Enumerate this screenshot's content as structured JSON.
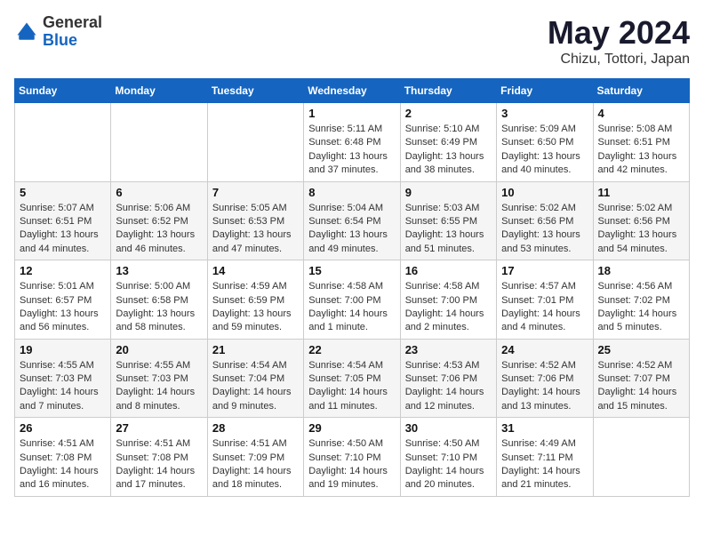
{
  "header": {
    "logo_general": "General",
    "logo_blue": "Blue",
    "month_title": "May 2024",
    "location": "Chizu, Tottori, Japan"
  },
  "weekdays": [
    "Sunday",
    "Monday",
    "Tuesday",
    "Wednesday",
    "Thursday",
    "Friday",
    "Saturday"
  ],
  "weeks": [
    [
      {
        "day": "",
        "info": ""
      },
      {
        "day": "",
        "info": ""
      },
      {
        "day": "",
        "info": ""
      },
      {
        "day": "1",
        "info": "Sunrise: 5:11 AM\nSunset: 6:48 PM\nDaylight: 13 hours and 37 minutes."
      },
      {
        "day": "2",
        "info": "Sunrise: 5:10 AM\nSunset: 6:49 PM\nDaylight: 13 hours and 38 minutes."
      },
      {
        "day": "3",
        "info": "Sunrise: 5:09 AM\nSunset: 6:50 PM\nDaylight: 13 hours and 40 minutes."
      },
      {
        "day": "4",
        "info": "Sunrise: 5:08 AM\nSunset: 6:51 PM\nDaylight: 13 hours and 42 minutes."
      }
    ],
    [
      {
        "day": "5",
        "info": "Sunrise: 5:07 AM\nSunset: 6:51 PM\nDaylight: 13 hours and 44 minutes."
      },
      {
        "day": "6",
        "info": "Sunrise: 5:06 AM\nSunset: 6:52 PM\nDaylight: 13 hours and 46 minutes."
      },
      {
        "day": "7",
        "info": "Sunrise: 5:05 AM\nSunset: 6:53 PM\nDaylight: 13 hours and 47 minutes."
      },
      {
        "day": "8",
        "info": "Sunrise: 5:04 AM\nSunset: 6:54 PM\nDaylight: 13 hours and 49 minutes."
      },
      {
        "day": "9",
        "info": "Sunrise: 5:03 AM\nSunset: 6:55 PM\nDaylight: 13 hours and 51 minutes."
      },
      {
        "day": "10",
        "info": "Sunrise: 5:02 AM\nSunset: 6:56 PM\nDaylight: 13 hours and 53 minutes."
      },
      {
        "day": "11",
        "info": "Sunrise: 5:02 AM\nSunset: 6:56 PM\nDaylight: 13 hours and 54 minutes."
      }
    ],
    [
      {
        "day": "12",
        "info": "Sunrise: 5:01 AM\nSunset: 6:57 PM\nDaylight: 13 hours and 56 minutes."
      },
      {
        "day": "13",
        "info": "Sunrise: 5:00 AM\nSunset: 6:58 PM\nDaylight: 13 hours and 58 minutes."
      },
      {
        "day": "14",
        "info": "Sunrise: 4:59 AM\nSunset: 6:59 PM\nDaylight: 13 hours and 59 minutes."
      },
      {
        "day": "15",
        "info": "Sunrise: 4:58 AM\nSunset: 7:00 PM\nDaylight: 14 hours and 1 minute."
      },
      {
        "day": "16",
        "info": "Sunrise: 4:58 AM\nSunset: 7:00 PM\nDaylight: 14 hours and 2 minutes."
      },
      {
        "day": "17",
        "info": "Sunrise: 4:57 AM\nSunset: 7:01 PM\nDaylight: 14 hours and 4 minutes."
      },
      {
        "day": "18",
        "info": "Sunrise: 4:56 AM\nSunset: 7:02 PM\nDaylight: 14 hours and 5 minutes."
      }
    ],
    [
      {
        "day": "19",
        "info": "Sunrise: 4:55 AM\nSunset: 7:03 PM\nDaylight: 14 hours and 7 minutes."
      },
      {
        "day": "20",
        "info": "Sunrise: 4:55 AM\nSunset: 7:03 PM\nDaylight: 14 hours and 8 minutes."
      },
      {
        "day": "21",
        "info": "Sunrise: 4:54 AM\nSunset: 7:04 PM\nDaylight: 14 hours and 9 minutes."
      },
      {
        "day": "22",
        "info": "Sunrise: 4:54 AM\nSunset: 7:05 PM\nDaylight: 14 hours and 11 minutes."
      },
      {
        "day": "23",
        "info": "Sunrise: 4:53 AM\nSunset: 7:06 PM\nDaylight: 14 hours and 12 minutes."
      },
      {
        "day": "24",
        "info": "Sunrise: 4:52 AM\nSunset: 7:06 PM\nDaylight: 14 hours and 13 minutes."
      },
      {
        "day": "25",
        "info": "Sunrise: 4:52 AM\nSunset: 7:07 PM\nDaylight: 14 hours and 15 minutes."
      }
    ],
    [
      {
        "day": "26",
        "info": "Sunrise: 4:51 AM\nSunset: 7:08 PM\nDaylight: 14 hours and 16 minutes."
      },
      {
        "day": "27",
        "info": "Sunrise: 4:51 AM\nSunset: 7:08 PM\nDaylight: 14 hours and 17 minutes."
      },
      {
        "day": "28",
        "info": "Sunrise: 4:51 AM\nSunset: 7:09 PM\nDaylight: 14 hours and 18 minutes."
      },
      {
        "day": "29",
        "info": "Sunrise: 4:50 AM\nSunset: 7:10 PM\nDaylight: 14 hours and 19 minutes."
      },
      {
        "day": "30",
        "info": "Sunrise: 4:50 AM\nSunset: 7:10 PM\nDaylight: 14 hours and 20 minutes."
      },
      {
        "day": "31",
        "info": "Sunrise: 4:49 AM\nSunset: 7:11 PM\nDaylight: 14 hours and 21 minutes."
      },
      {
        "day": "",
        "info": ""
      }
    ]
  ]
}
